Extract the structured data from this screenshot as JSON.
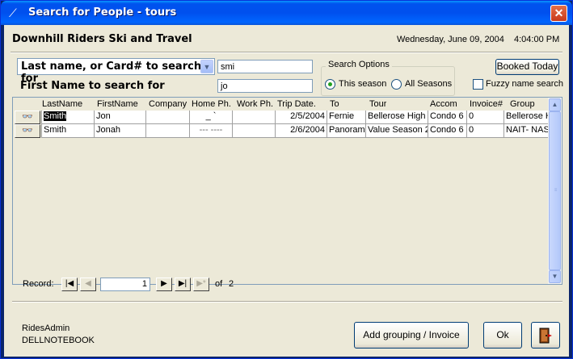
{
  "window": {
    "title": "Search for People - tours"
  },
  "header": {
    "company": "Downhill Riders Ski and Travel",
    "date": "Wednesday, June 09, 2004",
    "time": "4:04:00 PM"
  },
  "search": {
    "lastname_combo_label": "Last name, or Card# to search for",
    "lastname_value": "smi",
    "firstname_label": "First Name to search for",
    "firstname_value": "jo",
    "options_label": "Search Options",
    "option_this_season": "This season",
    "option_all_seasons": "All Seasons",
    "selected_option": "This season",
    "booked_today_label": "Booked Today",
    "fuzzy_label": "Fuzzy name search",
    "fuzzy_checked": false
  },
  "grid": {
    "columns": [
      "LastName",
      "FirstName",
      "Company",
      "Home Ph.",
      "Work Ph.",
      "Trip Date.",
      "To",
      "Tour",
      "Accom",
      "Invoice#",
      "Group"
    ],
    "rows": [
      {
        "lastname": "Smith",
        "firstname": "Jon",
        "company": "",
        "home_ph": "_ `",
        "work_ph": "",
        "trip_date": "2/5/2004",
        "to": "Fernie",
        "tour": "Bellerose High S",
        "accom": "Condo 6",
        "invoice": "0",
        "group": "Bellerose H"
      },
      {
        "lastname": "Smith",
        "firstname": "Jonah",
        "company": "",
        "home_ph": "--- ----",
        "work_ph": "",
        "trip_date": "2/6/2004",
        "to": "Panorama",
        "tour": "Value Season 2",
        "accom": "Condo 6",
        "invoice": "0",
        "group": "NAIT- NAS"
      }
    ],
    "row_button_icon": "glasses-icon"
  },
  "navigation": {
    "record_label": "Record:",
    "current_record": "1",
    "of_label": "of",
    "total_records": "2"
  },
  "footer": {
    "username": "RidesAdmin",
    "machine": "DELLNOTEBOOK",
    "add_grouping_label": "Add grouping / Invoice",
    "ok_label": "Ok",
    "exit_icon": "exit-door-icon"
  },
  "colors": {
    "title_bar": "#0053ee",
    "window_bg": "#ece9d8",
    "close_button": "#c8391c"
  }
}
